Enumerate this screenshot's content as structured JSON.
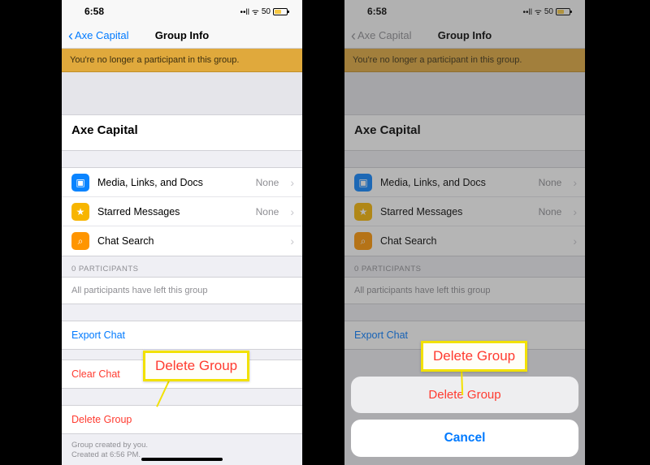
{
  "status": {
    "time": "6:58",
    "battery_pct": "50"
  },
  "nav": {
    "back_label": "Axe Capital",
    "title": "Group Info"
  },
  "banner": "You're no longer a participant in this group.",
  "group_name": "Axe Capital",
  "rows": {
    "media": {
      "label": "Media, Links, and Docs",
      "detail": "None"
    },
    "starred": {
      "label": "Starred Messages",
      "detail": "None"
    },
    "search": {
      "label": "Chat Search"
    }
  },
  "participants": {
    "header": "0 PARTICIPANTS",
    "note": "All participants have left this group"
  },
  "actions": {
    "export": "Export Chat",
    "clear": "Clear Chat",
    "delete": "Delete Group"
  },
  "footer": {
    "l1": "Group created by you.",
    "l2": "Created at 6:56 PM."
  },
  "callout": "Delete Group",
  "sheet": {
    "delete": "Delete Group",
    "cancel": "Cancel"
  }
}
